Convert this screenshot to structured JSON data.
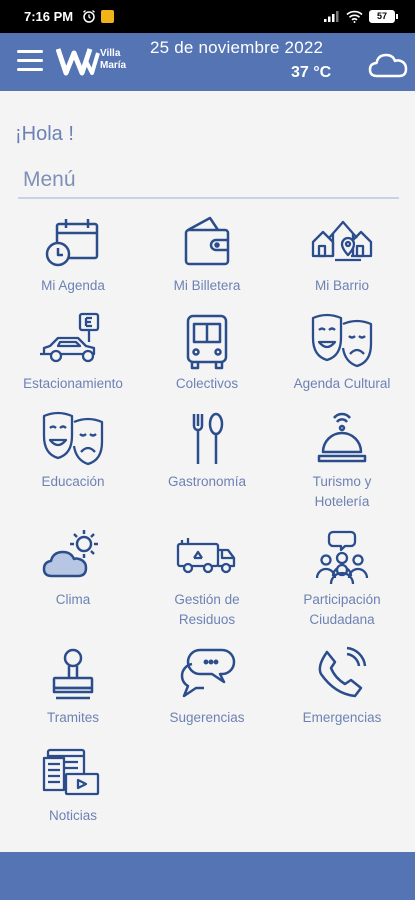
{
  "status_bar": {
    "time": "7:16 PM",
    "battery": "57",
    "icons": [
      "alarm-icon",
      "notification-icon",
      "signal-icon",
      "wifi-icon",
      "battery-icon"
    ]
  },
  "header": {
    "logo_text_line1": "Villa",
    "logo_text_line2": "María",
    "date": "25 de noviembre 2022",
    "temperature": "37 °C",
    "weather_icon": "cloud-icon",
    "menu_icon": "hamburger-icon"
  },
  "main": {
    "greeting": "¡Hola !",
    "menu_title": "Menú",
    "tiles": [
      {
        "label": "Mi Agenda",
        "icon": "calendar-clock-icon"
      },
      {
        "label": "Mi Billetera",
        "icon": "wallet-icon"
      },
      {
        "label": "Mi Barrio",
        "icon": "neighborhood-icon"
      },
      {
        "label": "Estacionamiento",
        "icon": "parking-car-icon"
      },
      {
        "label": "Colectivos",
        "icon": "bus-icon"
      },
      {
        "label": "Agenda Cultural",
        "icon": "theater-masks-icon"
      },
      {
        "label": "Educación",
        "icon": "theater-masks-icon"
      },
      {
        "label": "Gastronomía",
        "icon": "fork-spoon-icon"
      },
      {
        "label": "Turismo y",
        "label2": "Hotelería",
        "icon": "service-bell-icon"
      },
      {
        "label": "Clima",
        "icon": "sun-cloud-icon"
      },
      {
        "label": "Gestión de",
        "label2": "Residuos",
        "icon": "recycling-truck-icon"
      },
      {
        "label": "Participación",
        "label2": "Ciudadana",
        "icon": "group-chat-icon"
      },
      {
        "label": "Tramites",
        "icon": "stamp-icon"
      },
      {
        "label": "Sugerencias",
        "icon": "chat-bubbles-icon"
      },
      {
        "label": "Emergencias",
        "icon": "phone-icon"
      },
      {
        "label": "Noticias",
        "icon": "news-icon"
      }
    ]
  },
  "colors": {
    "primary": "#5474b4",
    "text": "#6d82b4",
    "icon_stroke": "#2b4d8c",
    "background": "#f4f4f4"
  }
}
